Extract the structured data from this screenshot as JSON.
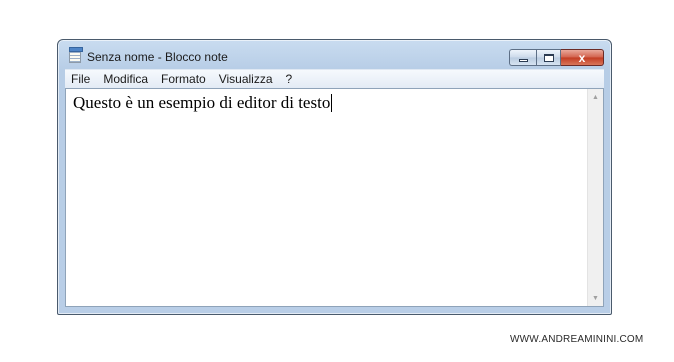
{
  "window": {
    "title": "Senza nome - Blocco note",
    "icons": {
      "app": "notepad-icon",
      "minimize": "minimize-icon",
      "maximize": "maximize-icon",
      "close": "close-icon"
    },
    "close_glyph": "x"
  },
  "menu": {
    "items": [
      {
        "label": "File"
      },
      {
        "label": "Modifica"
      },
      {
        "label": "Formato"
      },
      {
        "label": "Visualizza"
      },
      {
        "label": "?"
      }
    ]
  },
  "editor": {
    "content": "Questo è un esempio di editor di testo"
  },
  "scrollbar": {
    "up_glyph": "▲",
    "down_glyph": "▼"
  },
  "watermark": "WWW.ANDREAMININI.COM",
  "colors": {
    "frame": "#b9cee7",
    "close_button": "#c23b22",
    "menubar": "#e3ebf5"
  }
}
